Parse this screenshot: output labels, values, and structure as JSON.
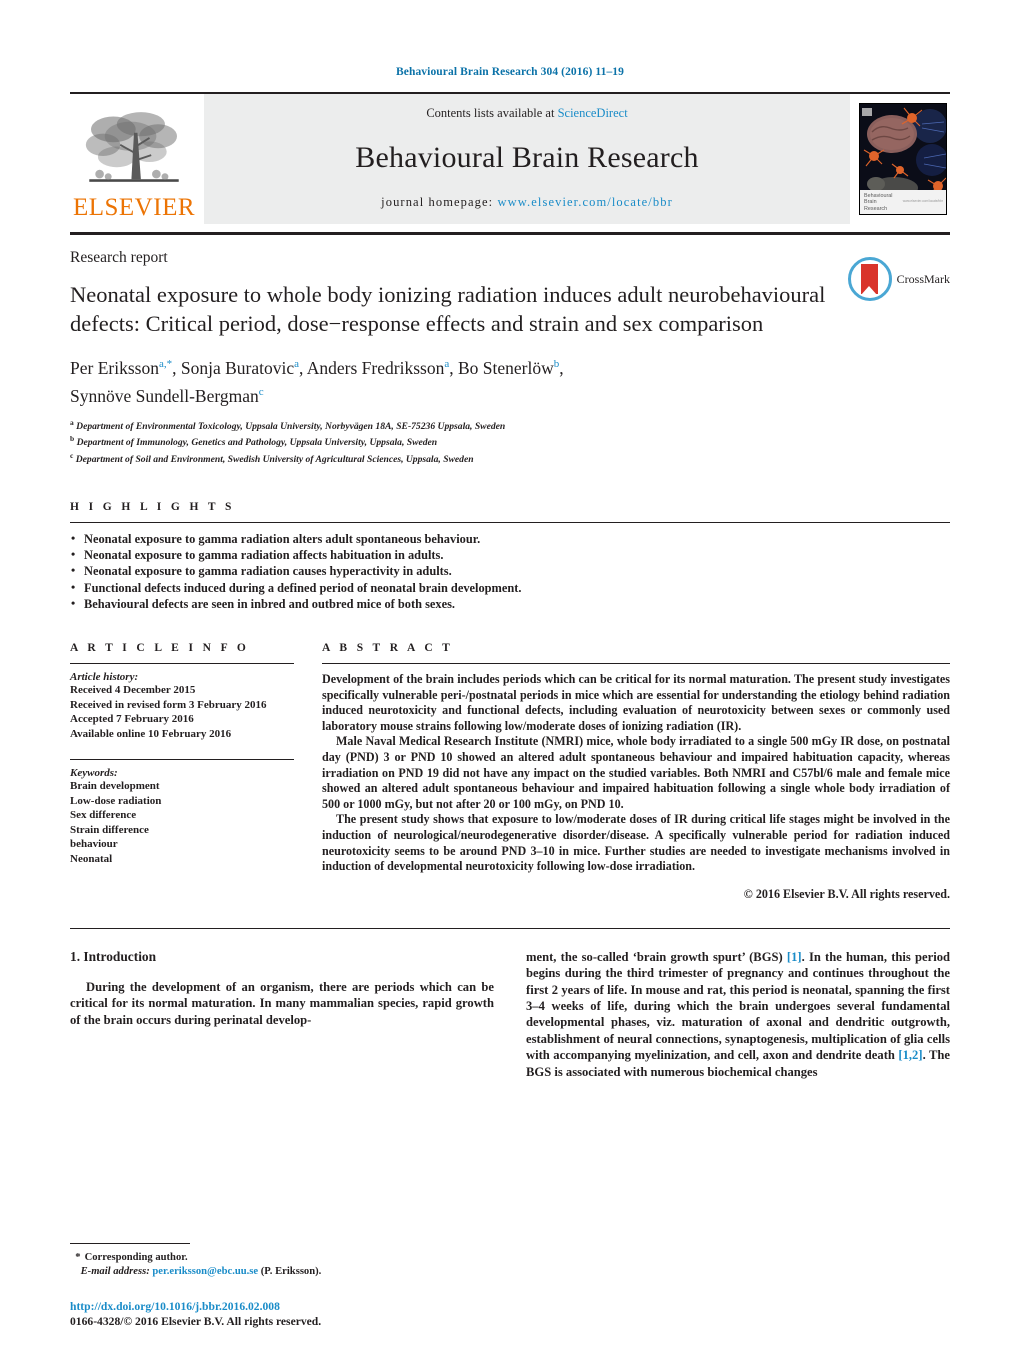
{
  "running_head": "Behavioural Brain Research 304 (2016) 11–19",
  "masthead": {
    "publisher_logo_text": "ELSEVIER",
    "contents_prefix": "Contents lists available at ",
    "contents_link": "ScienceDirect",
    "journal_title": "Behavioural Brain Research",
    "homepage_label": "journal homepage:",
    "homepage_url": "www.elsevier.com/locate/bbr",
    "cover_caption_line1": "Behavioural",
    "cover_caption_line2": "Brain",
    "cover_caption_line3": "Research",
    "cover_caption_tiny": "www.elsevier.com/locate/bbr"
  },
  "article": {
    "section_type": "Research report",
    "title": "Neonatal exposure to whole body ionizing radiation induces adult neurobehavioural defects: Critical period, dose−response effects and strain and sex comparison",
    "crossmark_label": "CrossMark",
    "authors_line1": "Per Eriksson",
    "authors_line1_sup": "a,*",
    "authors_rest": [
      {
        "name": ", Sonja Buratovic",
        "sup": "a"
      },
      {
        "name": ", Anders Fredriksson",
        "sup": "a"
      },
      {
        "name": ", Bo Stenerlöw",
        "sup": "b"
      }
    ],
    "authors_line2_name": "Synnöve Sundell-Bergman",
    "authors_line2_sup": "c",
    "affiliations": [
      {
        "marker": "a",
        "text": "Department of Environmental Toxicology, Uppsala University, Norbyvägen 18A, SE-75236 Uppsala, Sweden"
      },
      {
        "marker": "b",
        "text": "Department of Immunology, Genetics and Pathology, Uppsala University, Uppsala, Sweden"
      },
      {
        "marker": "c",
        "text": "Department of Soil and Environment, Swedish University of Agricultural Sciences, Uppsala, Sweden"
      }
    ]
  },
  "highlights": {
    "label": "H I G H L I G H T S",
    "items": [
      "Neonatal exposure to gamma radiation alters adult spontaneous behaviour.",
      "Neonatal exposure to gamma radiation affects habituation in adults.",
      "Neonatal exposure to gamma radiation causes hyperactivity in adults.",
      "Functional defects induced during a defined period of neonatal brain development.",
      "Behavioural defects are seen in inbred and outbred mice of both sexes."
    ]
  },
  "article_info": {
    "label": "A R T I C L E    I N F O",
    "history_head": "Article history:",
    "history": [
      "Received 4 December 2015",
      "Received in revised form 3 February 2016",
      "Accepted 7 February 2016",
      "Available online 10 February 2016"
    ],
    "keywords_head": "Keywords:",
    "keywords": [
      "Brain development",
      "Low-dose radiation",
      "Sex difference",
      "Strain difference",
      "behaviour",
      "Neonatal"
    ]
  },
  "abstract": {
    "label": "A B S T R A C T",
    "paragraphs": [
      "Development of the brain includes periods which can be critical for its normal maturation. The present study investigates specifically vulnerable peri-/postnatal periods in mice which are essential for understanding the etiology behind radiation induced neurotoxicity and functional defects, including evaluation of neurotoxicity between sexes or commonly used laboratory mouse strains following low/moderate doses of ionizing radiation (IR).",
      "Male Naval Medical Research Institute (NMRI) mice, whole body irradiated to a single 500 mGy IR dose, on postnatal day (PND) 3 or PND 10 showed an altered adult spontaneous behaviour and impaired habituation capacity, whereas irradiation on PND 19 did not have any impact on the studied variables. Both NMRI and C57bl/6 male and female mice showed an altered adult spontaneous behaviour and impaired habituation following a single whole body irradiation of 500 or 1000 mGy, but not after 20 or 100 mGy, on PND 10.",
      "The present study shows that exposure to low/moderate doses of IR during critical life stages might be involved in the induction of neurological/neurodegenerative disorder/disease. A specifically vulnerable period for radiation induced neurotoxicity seems to be around PND 3–10 in mice. Further studies are needed to investigate mechanisms involved in induction of developmental neurotoxicity following low-dose irradiation."
    ],
    "copyright": "© 2016 Elsevier B.V. All rights reserved."
  },
  "body": {
    "section_number_title": "1.  Introduction",
    "left_paragraph": "During the development of an organism, there are periods which can be critical for its normal maturation. In many mammalian species, rapid growth of the brain occurs during perinatal develop-",
    "right_paragraph_part1": "ment, the so-called ‘brain growth spurt’ (BGS) ",
    "right_ref1": "[1]",
    "right_paragraph_part2": ". In the human, this period begins during the third trimester of pregnancy and continues throughout the first 2 years of life. In mouse and rat, this period is neonatal, spanning the first 3–4 weeks of life, during which the brain undergoes several fundamental developmental phases, viz. maturation of axonal and dendritic outgrowth, establishment of neural connections, synaptogenesis, multiplication of glia cells with accompanying myelinization, and cell, axon and dendrite death ",
    "right_ref2": "[1,2]",
    "right_paragraph_part3": ". The BGS is associated with numerous biochemical changes"
  },
  "footer": {
    "corresponding_marker": "*",
    "corresponding_label": "Corresponding author.",
    "email_label": "E-mail address:",
    "email": "per.eriksson@ebc.uu.se",
    "email_suffix": "(P. Eriksson).",
    "doi": "http://dx.doi.org/10.1016/j.bbr.2016.02.008",
    "issn_line": "0166-4328/© 2016 Elsevier B.V. All rights reserved."
  },
  "colors": {
    "link_blue": "#1a8cc8",
    "header_blue": "#0b72a8",
    "elsevier_orange": "#ec7404",
    "band_grey": "#eceded",
    "ink": "#231f20"
  }
}
